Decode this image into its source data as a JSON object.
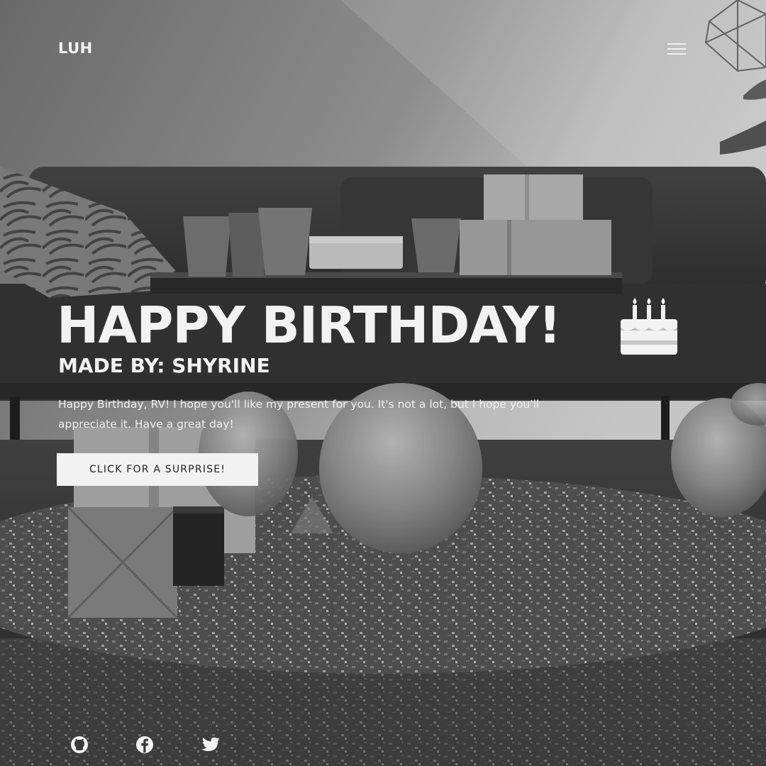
{
  "header": {
    "logo": "LUH"
  },
  "hero": {
    "title": "HAPPY BIRTHDAY!",
    "byline": "MADE BY: SHYRINE",
    "message": "Happy Birthday, RV! I hope you'll like my present for you. It's not a lot, but I hope you'll appreciate it. Have a great day!",
    "cta_label": "CLICK FOR A SURPRISE!"
  },
  "icons": {
    "menu": "hamburger-menu-icon",
    "cake": "birthday-cake-icon",
    "social": [
      "github-icon",
      "facebook-icon",
      "twitter-icon"
    ]
  },
  "colors": {
    "text": "#f2f2f2",
    "button_bg": "#f2f2f2",
    "button_text": "#222222"
  }
}
